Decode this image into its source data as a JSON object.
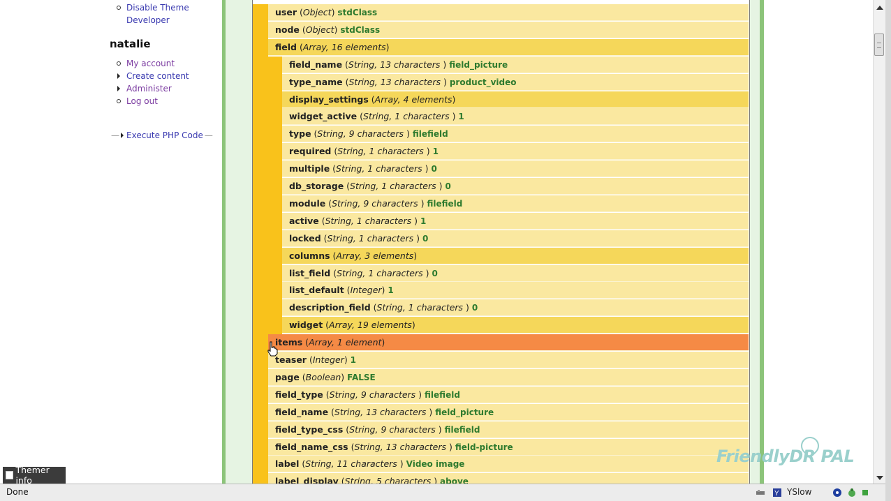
{
  "sidebar": {
    "top_links": [
      "Disable Theme",
      "Developer"
    ],
    "user_name": "natalie",
    "user_links": [
      {
        "label": "My account",
        "bullet": "circle"
      },
      {
        "label": "Create content",
        "bullet": "triangle"
      },
      {
        "label": "Administer",
        "bullet": "triangle"
      },
      {
        "label": "Log out",
        "bullet": "circle"
      }
    ],
    "execute_php": "Execute PHP Code"
  },
  "rows": [
    {
      "name": "user",
      "type": "Object",
      "value": "stdClass",
      "level": 0
    },
    {
      "name": "node",
      "type": "Object",
      "value": "stdClass",
      "level": 0
    },
    {
      "name": "field",
      "type": "Array, 16 elements",
      "value": "",
      "level": 0
    },
    {
      "name": "field_name",
      "type": "String, 13 characters ",
      "value": "field_picture",
      "level": 1
    },
    {
      "name": "type_name",
      "type": "String, 13 characters ",
      "value": "product_video",
      "level": 1
    },
    {
      "name": "display_settings",
      "type": "Array, 4 elements",
      "value": "",
      "level": 1
    },
    {
      "name": "widget_active",
      "type": "String, 1 characters ",
      "value": "1",
      "level": 1
    },
    {
      "name": "type",
      "type": "String, 9 characters ",
      "value": "filefield",
      "level": 1
    },
    {
      "name": "required",
      "type": "String, 1 characters ",
      "value": "1",
      "level": 1
    },
    {
      "name": "multiple",
      "type": "String, 1 characters ",
      "value": "0",
      "level": 1
    },
    {
      "name": "db_storage",
      "type": "String, 1 characters ",
      "value": "0",
      "level": 1
    },
    {
      "name": "module",
      "type": "String, 9 characters ",
      "value": "filefield",
      "level": 1
    },
    {
      "name": "active",
      "type": "String, 1 characters ",
      "value": "1",
      "level": 1
    },
    {
      "name": "locked",
      "type": "String, 1 characters ",
      "value": "0",
      "level": 1
    },
    {
      "name": "columns",
      "type": "Array, 3 elements",
      "value": "",
      "level": 1
    },
    {
      "name": "list_field",
      "type": "String, 1 characters ",
      "value": "0",
      "level": 1
    },
    {
      "name": "list_default",
      "type": "Integer",
      "value": "1",
      "level": 1
    },
    {
      "name": "description_field",
      "type": "String, 1 characters ",
      "value": "0",
      "level": 1
    },
    {
      "name": "widget",
      "type": "Array, 19 elements",
      "value": "",
      "level": 1
    },
    {
      "name": "items",
      "type": "Array, 1 element",
      "value": "",
      "level": 0,
      "hover": true
    },
    {
      "name": "teaser",
      "type": "Integer",
      "value": "1",
      "level": 0
    },
    {
      "name": "page",
      "type": "Boolean",
      "value": "FALSE",
      "level": 0
    },
    {
      "name": "field_type",
      "type": "String, 9 characters ",
      "value": "filefield",
      "level": 0
    },
    {
      "name": "field_name",
      "type": "String, 13 characters ",
      "value": "field_picture",
      "level": 0
    },
    {
      "name": "field_type_css",
      "type": "String, 9 characters ",
      "value": "filefield",
      "level": 0
    },
    {
      "name": "field_name_css",
      "type": "String, 13 characters ",
      "value": "field-picture",
      "level": 0
    },
    {
      "name": "label",
      "type": "String, 11 characters ",
      "value": "Video image",
      "level": 0
    },
    {
      "name": "label_display",
      "type": "String, 5 characters ",
      "value": "above",
      "level": 0
    }
  ],
  "themer": {
    "label": "Themer info"
  },
  "watermark": {
    "text": "FriendlyDR PAL"
  },
  "statusbar": {
    "status": "Done",
    "yslow": "YSlow"
  },
  "colors": {
    "row_light": "#fae8a0",
    "row_dark": "#f5d75a",
    "row_hover": "#f58a45",
    "gold_strip": "#f9c21b",
    "link": "#3a3ab0",
    "value_green": "#2e7a2e",
    "sidebar_green": "#8cc47a"
  },
  "icons": [
    "cursor-hand-icon",
    "plugin-icon",
    "yslow-icon",
    "addon-icon",
    "status-icon"
  ]
}
